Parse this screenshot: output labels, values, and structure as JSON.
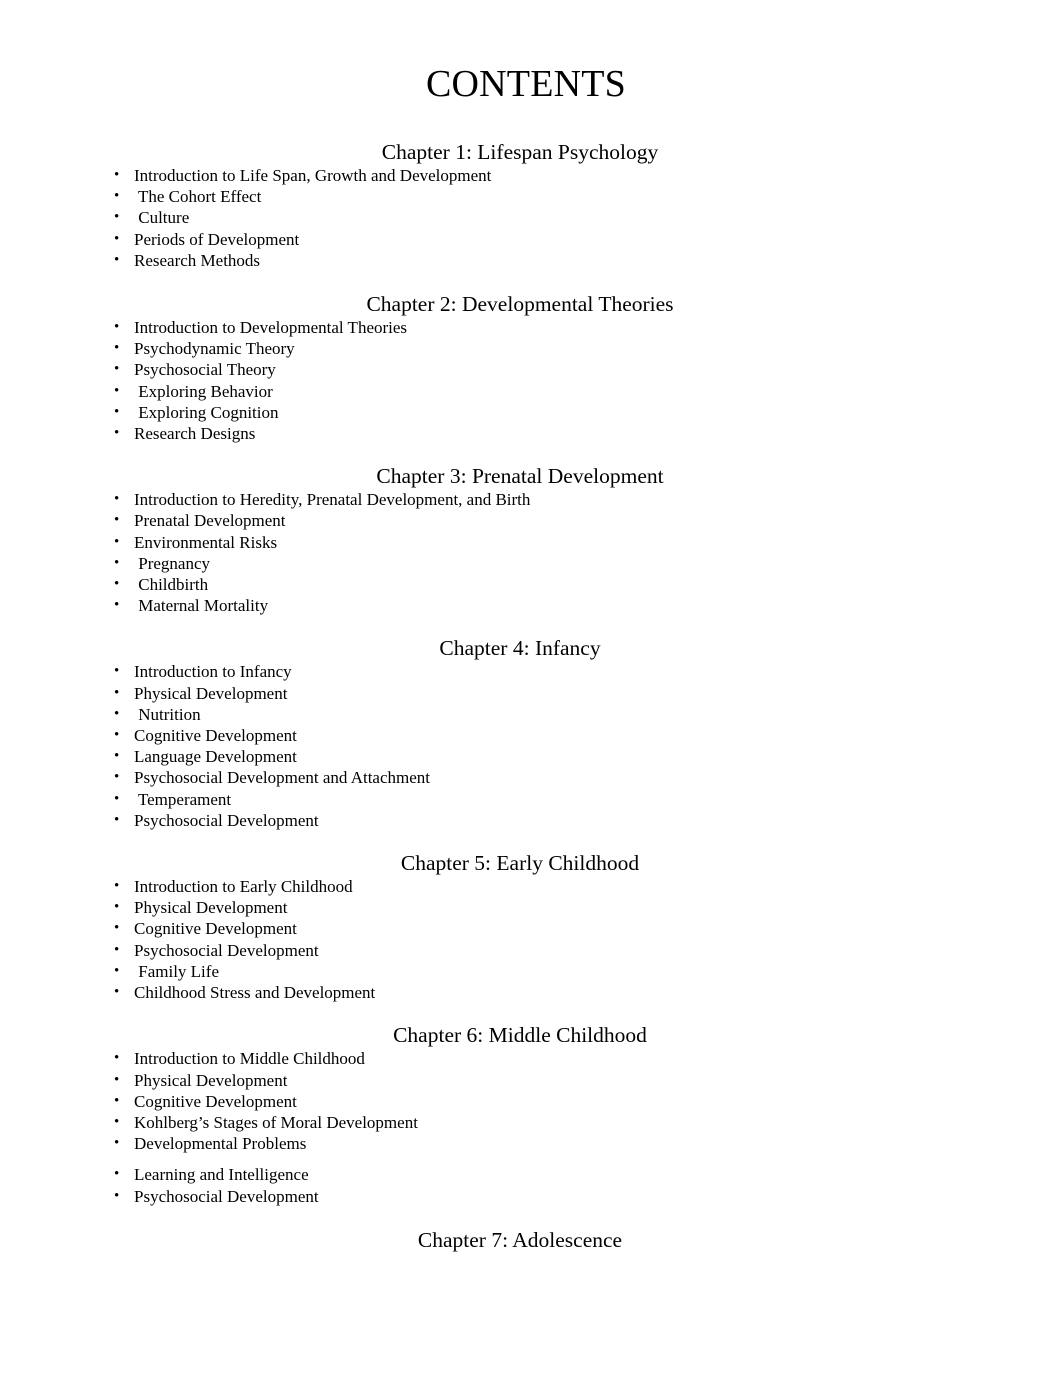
{
  "document": {
    "title": "CONTENTS",
    "bullet_glyph": "•",
    "text_color": "#000000",
    "background_color": "#ffffff"
  },
  "chapters": [
    {
      "heading": "Chapter 1: Lifespan Psychology",
      "items": [
        "Introduction to Life Span, Growth and Development",
        " The Cohort Effect",
        " Culture",
        "Periods of Development",
        "Research Methods"
      ]
    },
    {
      "heading": "Chapter 2: Developmental Theories",
      "items": [
        "Introduction to Developmental Theories",
        "Psychodynamic Theory",
        "Psychosocial Theory",
        " Exploring Behavior",
        " Exploring Cognition",
        "Research Designs"
      ]
    },
    {
      "heading": "Chapter 3: Prenatal Development",
      "items": [
        "Introduction to Heredity, Prenatal Development, and Birth",
        "Prenatal Development",
        "Environmental Risks",
        " Pregnancy",
        " Childbirth",
        " Maternal Mortality"
      ]
    },
    {
      "heading": "Chapter 4: Infancy",
      "items": [
        "Introduction to Infancy",
        "Physical Development",
        " Nutrition",
        "Cognitive Development",
        "Language Development",
        "Psychosocial Development and Attachment",
        " Temperament",
        "Psychosocial Development"
      ]
    },
    {
      "heading": "Chapter 5: Early Childhood",
      "items": [
        "Introduction to Early Childhood",
        "Physical Development",
        "Cognitive Development",
        "Psychosocial Development",
        " Family Life",
        "Childhood Stress and Development"
      ]
    },
    {
      "heading": "Chapter 6: Middle Childhood",
      "items": [
        "Introduction to Middle Childhood",
        "Physical Development",
        "Cognitive Development",
        "Kohlberg’s Stages of Moral Development",
        "Developmental Problems",
        "Learning and Intelligence",
        "Psychosocial Development"
      ]
    },
    {
      "heading": "Chapter 7: Adolescence",
      "items": []
    }
  ]
}
